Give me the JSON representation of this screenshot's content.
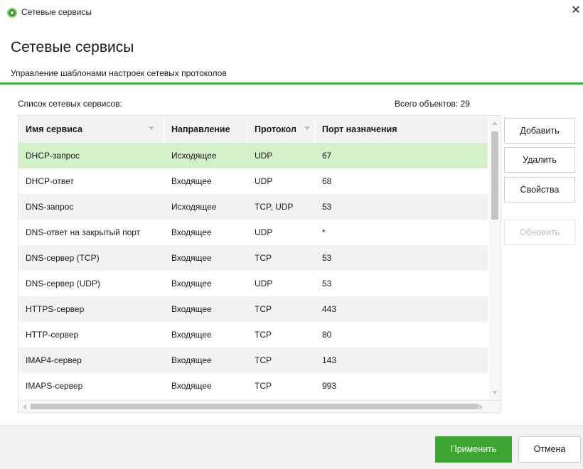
{
  "window": {
    "title": "Сетевые сервисы",
    "close_glyph": "✕",
    "icon": "app-shield-icon",
    "accent": "#4caf3f"
  },
  "header": {
    "title": "Сетевые сервисы",
    "subtitle": "Управление шаблонами настроек сетевых протоколов"
  },
  "list": {
    "label": "Список сетевых сервисов:",
    "count_label": "Всего объектов:",
    "count_value": "29"
  },
  "table": {
    "columns": [
      "Имя сервиса",
      "Направление",
      "Протокол",
      "Порт назначения"
    ],
    "selected_row": 0,
    "selected_color": "#d3f0c8",
    "rows": [
      [
        "DHCP-запрос",
        "Исходящее",
        "UDP",
        "67"
      ],
      [
        "DHCP-ответ",
        "Входящее",
        "UDP",
        "68"
      ],
      [
        "DNS-запрос",
        "Исходящее",
        "TCP, UDP",
        "53"
      ],
      [
        "DNS-ответ на закрытый порт",
        "Входящее",
        "UDP",
        "*"
      ],
      [
        "DNS-сервер (TCP)",
        "Входящее",
        "TCP",
        "53"
      ],
      [
        "DNS-сервер (UDP)",
        "Входящее",
        "UDP",
        "53"
      ],
      [
        "HTTPS-сервер",
        "Входящее",
        "TCP",
        "443"
      ],
      [
        "HTTP-сервер",
        "Входящее",
        "TCP",
        "80"
      ],
      [
        "IMAP4-сервер",
        "Входящее",
        "TCP",
        "143"
      ],
      [
        "IMAPS-сервер",
        "Входящее",
        "TCP",
        "993"
      ]
    ]
  },
  "actions": {
    "add": "Добавить",
    "delete": "Удалить",
    "properties": "Свойства",
    "refresh": "Обновить"
  },
  "footer": {
    "apply": "Применить",
    "cancel": "Отмена",
    "apply_color": "#3ea535"
  }
}
